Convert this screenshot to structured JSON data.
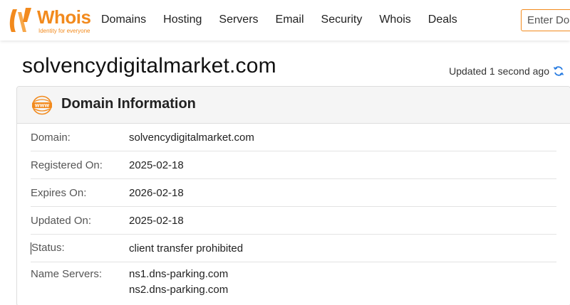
{
  "brand": {
    "name": "Whois",
    "tagline": "Identity for everyone",
    "accent_color": "#f28a1d"
  },
  "nav": {
    "items": [
      {
        "label": "Domains"
      },
      {
        "label": "Hosting"
      },
      {
        "label": "Servers"
      },
      {
        "label": "Email"
      },
      {
        "label": "Security"
      },
      {
        "label": "Whois"
      },
      {
        "label": "Deals"
      }
    ]
  },
  "search": {
    "placeholder": "Enter Domain or IP"
  },
  "page": {
    "title": "solvencydigitalmarket.com",
    "updated_text": "Updated 1 second ago",
    "refresh_icon": "refresh-icon"
  },
  "card": {
    "icon": "www-icon",
    "title": "Domain Information",
    "rows": [
      {
        "label": "Domain:",
        "value": "solvencydigitalmarket.com"
      },
      {
        "label": "Registered On:",
        "value": "2025-02-18"
      },
      {
        "label": "Expires On:",
        "value": "2026-02-18"
      },
      {
        "label": "Updated On:",
        "value": "2025-02-18"
      },
      {
        "label": "Status:",
        "value": "client transfer prohibited"
      },
      {
        "label": "Name Servers:",
        "values": [
          "ns1.dns-parking.com",
          "ns2.dns-parking.com"
        ]
      }
    ]
  }
}
